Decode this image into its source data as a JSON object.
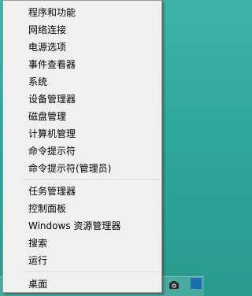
{
  "menu": {
    "group1": [
      "程序和功能",
      "网络连接",
      "电源选项",
      "事件查看器",
      "系统",
      "设备管理器",
      "磁盘管理",
      "计算机管理",
      "命令提示符",
      "命令提示符(管理员)"
    ],
    "group2": [
      "任务管理器",
      "控制面板",
      "Windows 资源管理器",
      "搜索",
      "运行"
    ],
    "desktop_label": "桌面"
  },
  "tray": {
    "camera_icon": "camera-icon",
    "flag_icon": "flag-icon"
  }
}
